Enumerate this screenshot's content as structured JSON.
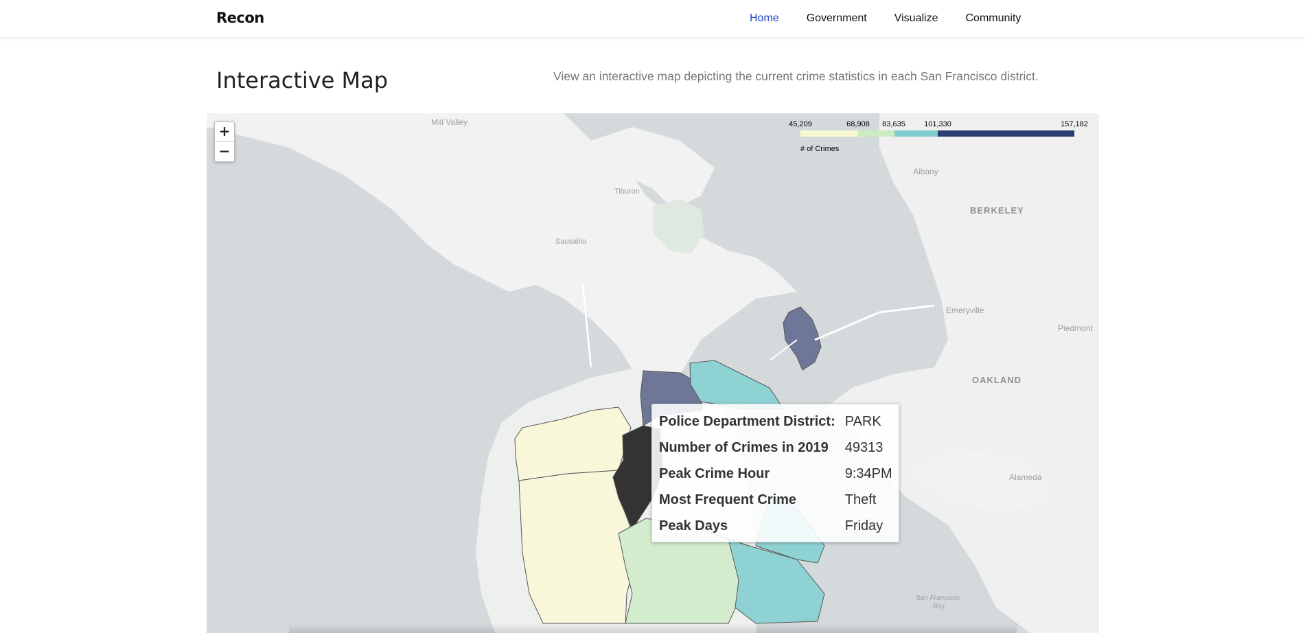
{
  "nav": {
    "brand": "Recon",
    "links": [
      {
        "label": "Home",
        "active": true
      },
      {
        "label": "Government",
        "active": false
      },
      {
        "label": "Visualize",
        "active": false
      },
      {
        "label": "Community",
        "active": false
      }
    ]
  },
  "header": {
    "title": "Interactive Map",
    "description": "View an interactive map depicting the current crime statistics in each San Francisco district."
  },
  "map": {
    "zoom_in": "+",
    "zoom_out": "−",
    "place_labels": {
      "mill_valley": "Mill Valley",
      "tiburon": "Tiburon",
      "sausalito": "Sausalito",
      "albany": "Albany",
      "berkeley": "BERKELEY",
      "emeryville": "Emeryville",
      "piedmont": "Piedmont",
      "oakland": "OAKLAND",
      "alameda": "Alameda",
      "sf_bay_1": "San Francisco",
      "sf_bay_2": "Bay"
    },
    "legend": {
      "title": "# of Crimes",
      "ticks": [
        "45,209",
        "68,908",
        "83,635",
        "101,330",
        "157,182"
      ],
      "bins": [
        {
          "from": 45209,
          "to": 68908,
          "color": "#f7f7d2"
        },
        {
          "from": 68908,
          "to": 83635,
          "color": "#cdebc3"
        },
        {
          "from": 83635,
          "to": 101330,
          "color": "#7fcdcd"
        },
        {
          "from": 101330,
          "to": 157182,
          "color": "#2b3e74"
        }
      ]
    },
    "district_colors": {
      "low": "#f8f7da",
      "mid_low": "#d3ecce",
      "mid": "#8ed2d3",
      "high": "#6f7799",
      "selected": "#333333"
    },
    "popup": {
      "rows": [
        {
          "label": "Police Department District:",
          "value": "PARK"
        },
        {
          "label": "Number of Crimes in 2019",
          "value": "49313"
        },
        {
          "label": "Peak Crime Hour",
          "value": "9:34PM"
        },
        {
          "label": "Most Frequent Crime",
          "value": "Theft"
        },
        {
          "label": "Peak Days",
          "value": "Friday"
        }
      ]
    }
  }
}
